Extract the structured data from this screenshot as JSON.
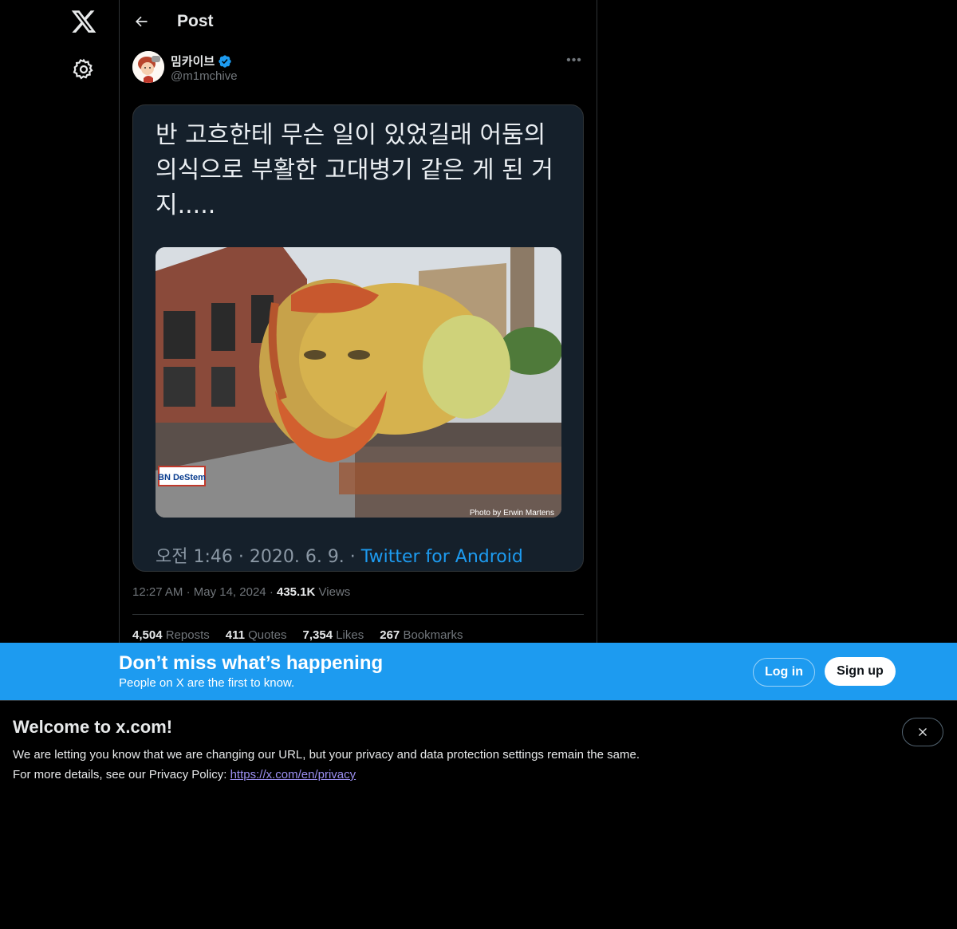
{
  "nav": {
    "logo_icon": "x-logo-icon",
    "settings_icon": "gear-icon"
  },
  "header": {
    "back_icon": "arrow-left-icon",
    "title": "Post"
  },
  "post": {
    "author_name": "밈카이브",
    "author_handle": "@m1mchive",
    "verified_icon": "verified-badge-icon",
    "more_icon": "more-horizontal-icon",
    "media": {
      "screenshot_text": "반 고흐한테 무슨 일이 있었길래 어둠의 의식으로 부활한 고대병기 같은 게 된 거지.....",
      "photo_credit": "Photo by Erwin Martens",
      "banner_text": "BN DeStem",
      "caption_time": "오전 1:46 · 2020. 6. 9. · ",
      "caption_source": "Twitter for Android"
    },
    "time": "12:27 AM",
    "date": "May 14, 2024",
    "views_count": "435.1K",
    "views_label": "Views",
    "stats": [
      {
        "count": "4,504",
        "label": "Reposts"
      },
      {
        "count": "411",
        "label": "Quotes"
      },
      {
        "count": "7,354",
        "label": "Likes"
      },
      {
        "count": "267",
        "label": "Bookmarks"
      }
    ]
  },
  "banner": {
    "title": "Don’t miss what’s happening",
    "subtitle": "People on X are the first to know.",
    "login_label": "Log in",
    "signup_label": "Sign up",
    "bg_color": "#1d9bf0"
  },
  "welcome": {
    "title": "Welcome to x.com!",
    "line1": "We are letting you know that we are changing our URL, but your privacy and data protection settings remain the same.",
    "line2_prefix": "For more details, see our Privacy Policy: ",
    "link_text": "https://x.com/en/privacy",
    "close_icon": "close-icon"
  }
}
